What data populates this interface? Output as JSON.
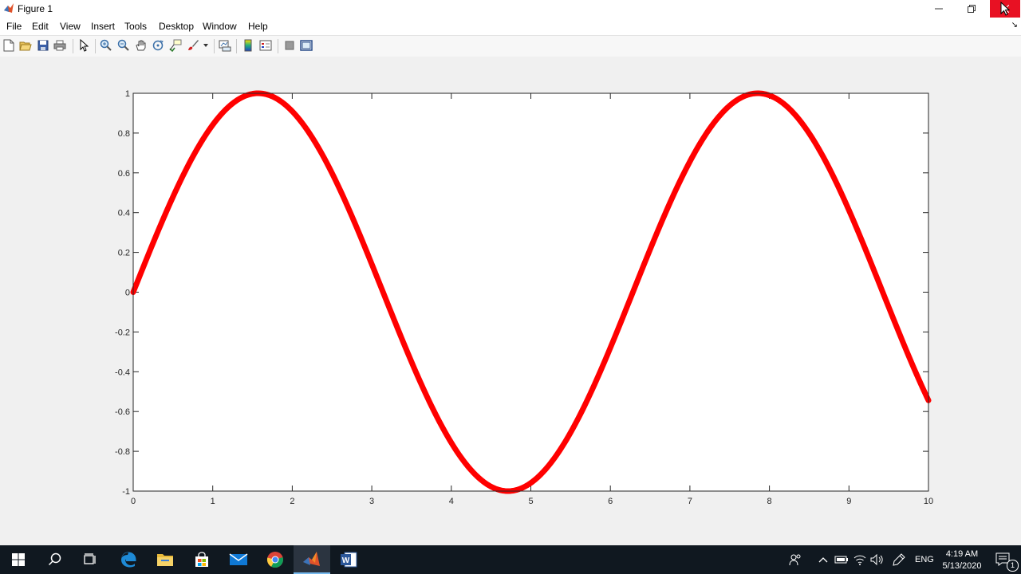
{
  "window": {
    "title": "Figure 1"
  },
  "menu": [
    "File",
    "Edit",
    "View",
    "Insert",
    "Tools",
    "Desktop",
    "Window",
    "Help"
  ],
  "toolbar": {
    "icons": [
      "new-figure-icon",
      "open-file-icon",
      "save-icon",
      "print-icon",
      "edit-plot-icon",
      "zoom-in-icon",
      "zoom-out-icon",
      "pan-icon",
      "rotate-3d-icon",
      "data-cursor-icon",
      "brush-icon",
      "link-plot-icon",
      "insert-colorbar-icon",
      "insert-legend-icon",
      "hide-plot-tools-icon",
      "show-plot-tools-icon"
    ]
  },
  "chart_data": {
    "type": "line",
    "function": "sin(x)",
    "x_start": 0,
    "x_end": 10,
    "xlim": [
      0,
      10
    ],
    "ylim": [
      -1,
      1
    ],
    "xticks": [
      "0",
      "1",
      "2",
      "3",
      "4",
      "5",
      "6",
      "7",
      "8",
      "9",
      "10"
    ],
    "yticks": [
      "1",
      "0.8",
      "0.6",
      "0.4",
      "0.2",
      "0",
      "-0.2",
      "-0.4",
      "-0.6",
      "-0.8",
      "-1"
    ],
    "line_color": "#ff0000",
    "grid": false,
    "title": "",
    "xlabel": "",
    "ylabel": ""
  },
  "taskbar": {
    "apps": [
      "windows-start-icon",
      "search-icon",
      "task-view-icon",
      "edge-icon",
      "file-explorer-icon",
      "store-icon",
      "mail-icon",
      "chrome-icon",
      "matlab-icon",
      "word-icon"
    ],
    "language": "ENG",
    "time": "4:19 AM",
    "date": "5/13/2020",
    "notification_count": "1"
  }
}
